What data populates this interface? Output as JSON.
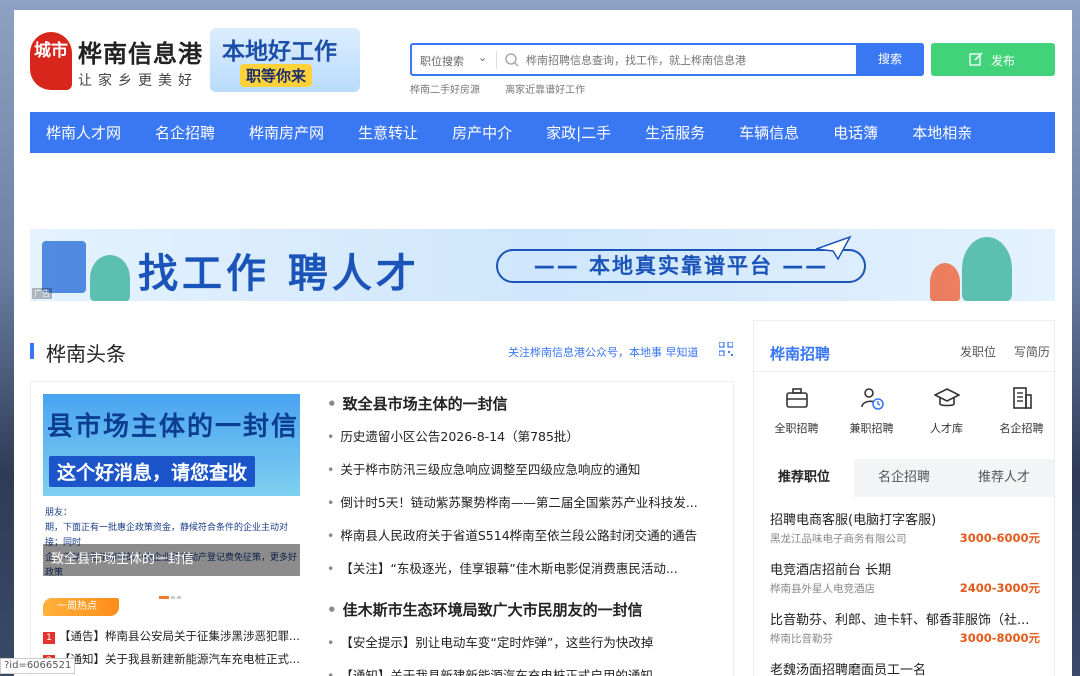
{
  "header": {
    "logo_mark": "城市",
    "site_name": "桦南信息港",
    "slogan": "让家乡更美好",
    "promo_line1": "本地好工作",
    "promo_line2": "职等你来",
    "search": {
      "category": "职位搜索",
      "placeholder": "桦南招聘信息查询，找工作，就上桦南信息港",
      "button": "搜索"
    },
    "hot_links": [
      "桦南二手好房源",
      "离家近靠谱好工作"
    ],
    "publish_button": "发布"
  },
  "nav": [
    "桦南人才网",
    "名企招聘",
    "桦南房产网",
    "生意转让",
    "房产中介",
    "家政|二手",
    "生活服务",
    "车辆信息",
    "电话簿",
    "本地相亲"
  ],
  "banner": {
    "main_text": "找工作 聘人才",
    "pill_text": "—— 本地真实靠谱平台 ——",
    "ad_tag": "广告"
  },
  "headlines": {
    "title": "桦南头条",
    "follow_text": "关注桦南信息港公众号，本地事 早知道",
    "image": {
      "title_text": "县市场主体的一封信",
      "subtitle_text": "这个好消息，请您查收",
      "body_text": "朋友：\n期，下面正有一批惠企政策资金，静候符合条件的企业主动对接；同时\n企，不动产登记即可的小微企业和不动产登记费免征策，更多好政策\n都可以在我们的'经常合生'上申报，省时省力。",
      "caption": "致全县市场主体的一封信"
    },
    "hot_badge": "一周热点",
    "hot_items": [
      {
        "num": "1",
        "text": "【通告】桦南县公安局关于征集涉黑涉恶犯罪..."
      },
      {
        "num": "2",
        "text": "【通知】关于我县新建新能源汽车充电桩正式..."
      }
    ],
    "news": [
      {
        "text": "致全县市场主体的一封信",
        "head": true
      },
      {
        "text": "历史遗留小区公告2026-8-14（第785批）",
        "head": false
      },
      {
        "text": "关于桦市防汛三级应急响应调整至四级应急响应的通知",
        "head": false
      },
      {
        "text": "倒计时5天！链动紫苏聚势桦南——第二届全国紫苏产业科技发...",
        "head": false
      },
      {
        "text": "桦南县人民政府关于省道S514桦南至依兰段公路封闭交通的通告",
        "head": false
      },
      {
        "text": "【关注】“东极逐光，佳享银幕”佳木斯电影促消费惠民活动...",
        "head": false
      },
      {
        "text": "佳木斯市生态环境局致广大市民朋友的一封信",
        "head": true
      },
      {
        "text": "【安全提示】别让电动车变“定时炸弹”，这些行为快改掉",
        "head": false
      },
      {
        "text": "【通知】关于我县新建新能源汽车充电桩正式启用的通知",
        "head": false
      }
    ]
  },
  "jobs_panel": {
    "title": "桦南招聘",
    "links": [
      "发职位",
      "写简历"
    ],
    "categories": [
      {
        "label": "全职招聘",
        "icon": "briefcase-icon"
      },
      {
        "label": "兼职招聘",
        "icon": "person-clock-icon"
      },
      {
        "label": "人才库",
        "icon": "graduation-cap-icon"
      },
      {
        "label": "名企招聘",
        "icon": "building-icon"
      }
    ],
    "tabs": [
      "推荐职位",
      "名企招聘",
      "推荐人才"
    ],
    "active_tab": "推荐职位",
    "jobs": [
      {
        "title": "招聘电商客服(电脑打字客服)",
        "company": "黑龙江品味电子商务有限公司",
        "salary": "3000-6000元"
      },
      {
        "title": "电竞酒店招前台 长期",
        "company": "桦南县外星人电竞酒店",
        "salary": "2400-3000元"
      },
      {
        "title": "比音勒芬、利郎、迪卡轩、郁香菲服饰（社...",
        "company": "桦南比音勒芬",
        "salary": "3000-8000元"
      },
      {
        "title": "老魏汤面招聘磨面员工一名",
        "company": "",
        "salary": ""
      }
    ]
  },
  "status_bar": {
    "url": "?id=6066521"
  },
  "colors": {
    "primary": "#3a77f2",
    "publish": "#41d27a",
    "salary": "#e35a1b",
    "hot": "#e3322a"
  }
}
